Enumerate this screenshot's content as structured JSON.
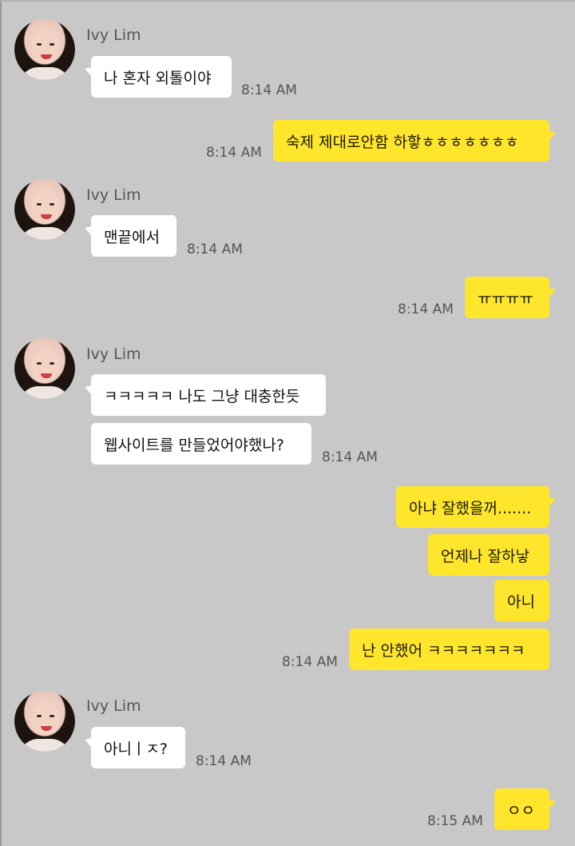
{
  "contact": {
    "name": "Ivy Lim"
  },
  "messages": [
    {
      "dir": "in",
      "show_sender": true,
      "texts": [
        "나 혼자 외톨이야"
      ],
      "time": "8:14 AM"
    },
    {
      "dir": "out",
      "texts": [
        "숙제 제대로안함 하핳ㅎㅎㅎㅎㅎㅎㅎ"
      ],
      "time": "8:14 AM"
    },
    {
      "dir": "in",
      "show_sender": true,
      "texts": [
        "맨끝에서"
      ],
      "time": "8:14 AM"
    },
    {
      "dir": "out",
      "texts": [
        "ㅠㅠㅠㅠ"
      ],
      "time": "8:14 AM"
    },
    {
      "dir": "in",
      "show_sender": true,
      "texts": [
        "ㅋㅋㅋㅋㅋ 나도 그냥 대충한듯",
        "웹사이트를 만들었어야했나?"
      ],
      "time": "8:14 AM"
    },
    {
      "dir": "out",
      "texts": [
        "아냐 잘했을꺼.......",
        "언제나 잘하낳",
        "아니",
        "난 안했어 ㅋㅋㅋㅋㅋㅋㅋ"
      ],
      "time": "8:14 AM"
    },
    {
      "dir": "in",
      "show_sender": true,
      "texts": [
        "아니ㅣㅈ?"
      ],
      "time": "8:14 AM"
    },
    {
      "dir": "out",
      "texts": [
        "ㅇㅇ"
      ],
      "time": "8:15 AM"
    }
  ]
}
